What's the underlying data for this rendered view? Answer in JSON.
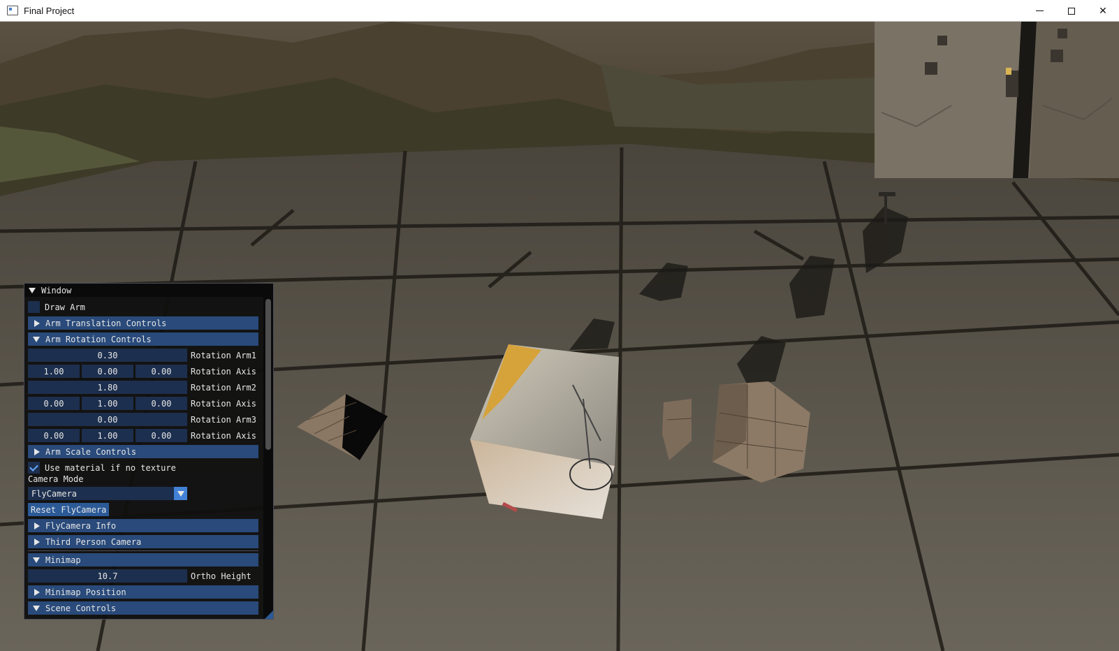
{
  "window": {
    "title": "Final Project",
    "icon": "app-window-icon",
    "controls": {
      "minimize": "minimize-icon",
      "maximize": "maximize-icon",
      "close": "close-icon"
    }
  },
  "imgui": {
    "title": "Window",
    "draw_arm_label": "Draw Arm",
    "draw_arm_checked": false,
    "headers": {
      "arm_translation": "Arm Translation Controls",
      "arm_rotation": "Arm Rotation Controls",
      "arm_scale": "Arm Scale Controls",
      "flycamera_info": "FlyCamera Info",
      "third_person": "Third Person Camera",
      "minimap": "Minimap",
      "minimap_position": "Minimap Position",
      "scene_controls": "Scene Controls"
    },
    "rotation": {
      "arm1": "0.30",
      "arm1_label": "Rotation Arm1",
      "axis1": [
        "1.00",
        "0.00",
        "0.00"
      ],
      "axis1_label": "Rotation Axis",
      "arm2": "1.80",
      "arm2_label": "Rotation Arm2",
      "axis2": [
        "0.00",
        "1.00",
        "0.00"
      ],
      "axis2_label": "Rotation Axis",
      "arm3": "0.00",
      "arm3_label": "Rotation Arm3",
      "axis3": [
        "0.00",
        "1.00",
        "0.00"
      ],
      "axis3_label": "Rotation Axis"
    },
    "use_material_label": "Use material if no texture",
    "use_material_checked": true,
    "camera_mode_label": "Camera Mode",
    "camera_mode_value": "FlyCamera",
    "reset_button": "Reset FlyCamera",
    "ortho_height_value": "10.7",
    "ortho_height_label": "Ortho Height"
  },
  "colors": {
    "header_bg": "#294a7a",
    "frame_bg": "#1d2f4e",
    "button_bg": "#2b5a97",
    "accent": "#4282d6",
    "check": "#66a8ff"
  }
}
